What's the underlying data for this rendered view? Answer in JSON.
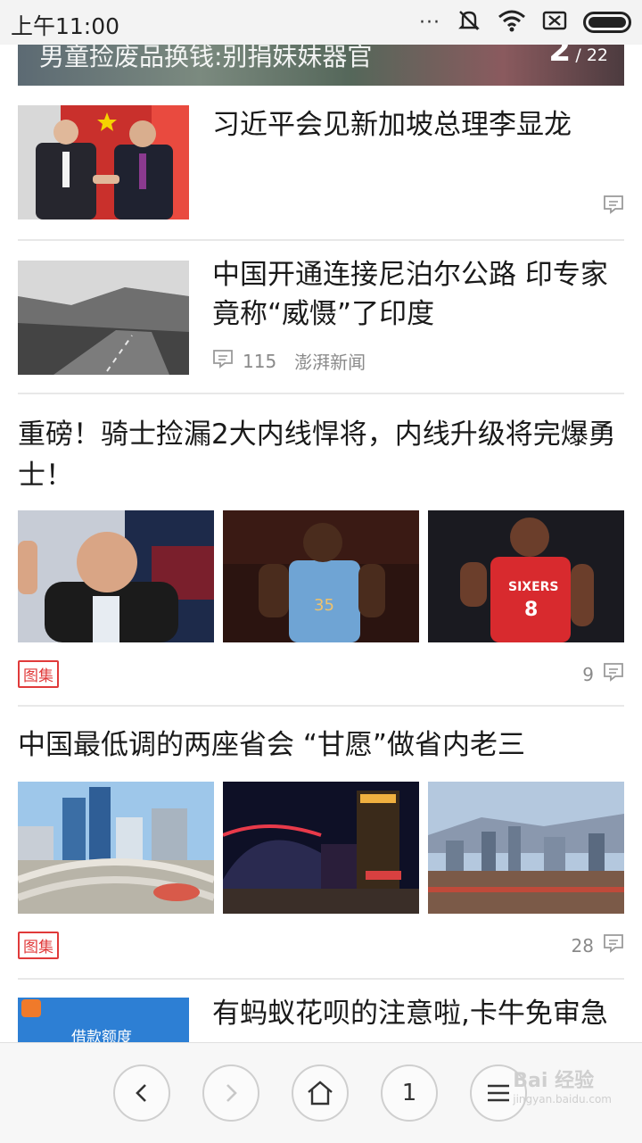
{
  "status_bar": {
    "time": "上午11:00",
    "dots": "···"
  },
  "banner": {
    "title": "男童捡废品换钱:别捐妹妹器官",
    "current_page": "2",
    "total_pages": "/ 22"
  },
  "news": [
    {
      "title": "习近平会见新加坡总理李显龙"
    },
    {
      "title": "中国开通连接尼泊尔公路 印专家竟称“威慑”了印度",
      "comments": "115",
      "source": "澎湃新闻"
    },
    {
      "title": "重磅！骑士捡漏2大内线悍将，内线升级将完爆勇士！",
      "tag": "图集",
      "comments": "9"
    },
    {
      "title": "中国最低调的两座省会 “甘愿”做省内老三",
      "tag": "图集",
      "comments": "28"
    },
    {
      "title": "有蚂蚁花呗的注意啦,卡牛免审急",
      "thumb_text": "借款额度"
    }
  ],
  "bottom_bar": {
    "tab_count": "1",
    "watermark": "Bai 经验",
    "watermark_sub": "jingyan.baidu.com"
  },
  "colors": {
    "tag_red": "#e03a3a",
    "meta_gray": "#8a8a8a",
    "divider": "#e8e8e8"
  }
}
